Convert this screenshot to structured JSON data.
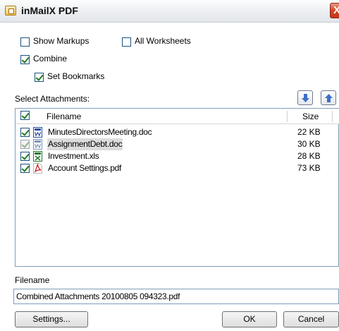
{
  "window": {
    "title": "inMailX PDF",
    "close_glyph": "X"
  },
  "options": {
    "show_markups": {
      "label": "Show Markups",
      "checked": false
    },
    "all_worksheets": {
      "label": "All Worksheets",
      "checked": false
    },
    "combine": {
      "label": "Combine",
      "checked": true
    },
    "set_bookmarks": {
      "label": "Set Bookmarks",
      "checked": true
    }
  },
  "attachments": {
    "label": "Select Attachments:",
    "move_down_icon": "arrow-down-icon",
    "move_up_icon": "arrow-up-icon",
    "columns": {
      "filename": "Filename",
      "size": "Size"
    },
    "rows": [
      {
        "name": "MinutesDirectorsMeeting.doc",
        "size": "22 KB",
        "checked": true,
        "icon": "word-doc-icon"
      },
      {
        "name": "AssignmentDebt.doc",
        "size": "30 KB",
        "checked": true,
        "icon": "word-doc-icon"
      },
      {
        "name": "Investment.xls",
        "size": "28 KB",
        "checked": true,
        "icon": "excel-xls-icon"
      },
      {
        "name": "Account Settings.pdf",
        "size": "73 KB",
        "checked": true,
        "icon": "pdf-icon"
      }
    ]
  },
  "output": {
    "label": "Filename",
    "value": "Combined Attachments 20100805 094323.pdf"
  },
  "buttons": {
    "settings": "Settings...",
    "ok": "OK",
    "cancel": "Cancel"
  },
  "colors": {
    "accent_blue": "#3c6fc8",
    "close_red": "#d4472a",
    "check_green": "#217a21"
  }
}
